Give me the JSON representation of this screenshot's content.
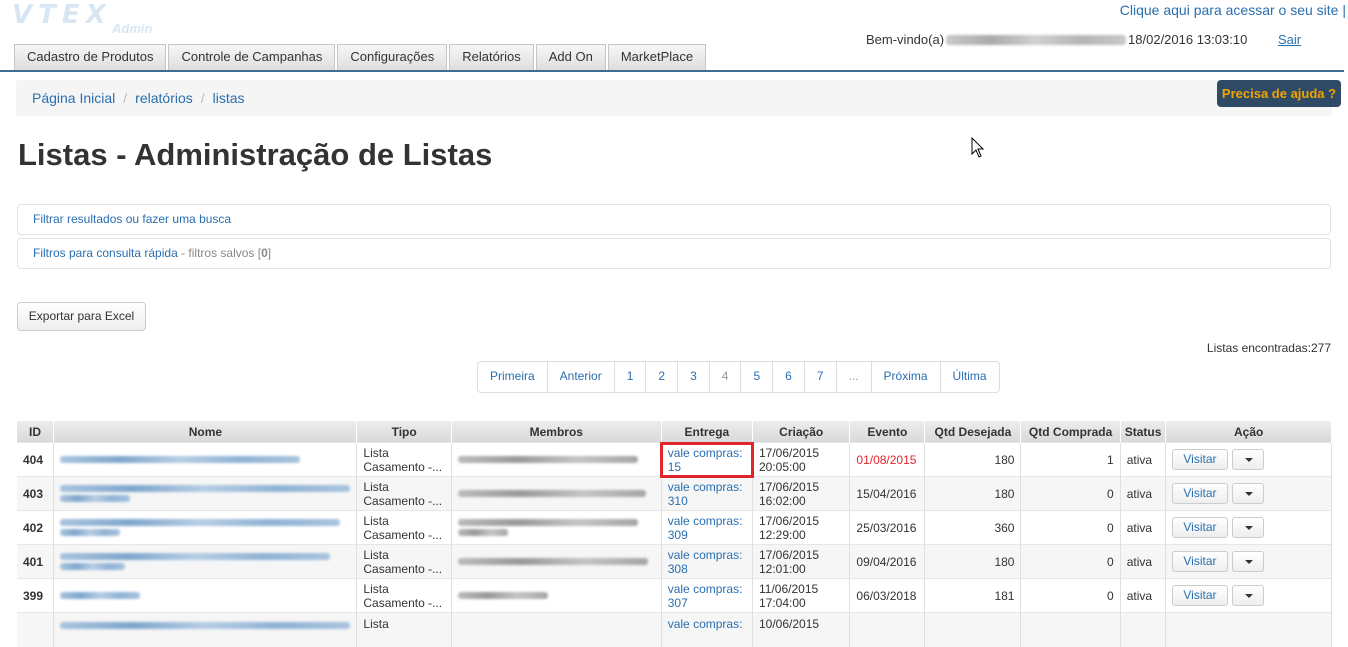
{
  "logo": {
    "main": "VTEX",
    "sub": "Admin"
  },
  "header": {
    "site_link": "Clique aqui para acessar o seu site |",
    "welcome_prefix": "Bem-vindo(a)",
    "datetime": "18/02/2016 13:03:10",
    "logout": "Sair"
  },
  "tabs": [
    "Cadastro de Produtos",
    "Controle de Campanhas",
    "Configurações",
    "Relatórios",
    "Add On",
    "MarketPlace"
  ],
  "breadcrumb": [
    "Página Inicial",
    "relatórios",
    "listas"
  ],
  "help_button": "Precisa de ajuda ?",
  "page_title": "Listas - Administração de Listas",
  "filter_panel": "Filtrar resultados ou fazer uma busca",
  "quick_filter": {
    "label": "Filtros para consulta rápida",
    "saved_prefix": " - filtros salvos [",
    "saved_count": "0",
    "saved_suffix": "]"
  },
  "export_button": "Exportar para Excel",
  "found_text": "Listas encontradas:277",
  "pagination": [
    "Primeira",
    "Anterior",
    "1",
    "2",
    "3",
    "4",
    "5",
    "6",
    "7",
    "...",
    "Próxima",
    "Última"
  ],
  "table": {
    "headers": [
      "ID",
      "Nome",
      "Tipo",
      "Membros",
      "Entrega",
      "Criação",
      "Evento",
      "Qtd Desejada",
      "Qtd Comprada",
      "Status",
      "Ação"
    ],
    "visit_label": "Visitar",
    "rows": [
      {
        "id": "404",
        "tipo1": "Lista",
        "tipo2": "Casamento -...",
        "entrega1": "vale compras:",
        "entrega2": "15",
        "criacao1": "17/06/2015",
        "criacao2": "20:05:00",
        "evento": "01/08/2015",
        "desejada": "180",
        "comprada": "1",
        "status": "ativa"
      },
      {
        "id": "403",
        "tipo1": "Lista",
        "tipo2": "Casamento -...",
        "entrega1": "vale compras:",
        "entrega2": "310",
        "criacao1": "17/06/2015",
        "criacao2": "16:02:00",
        "evento": "15/04/2016",
        "desejada": "180",
        "comprada": "0",
        "status": "ativa"
      },
      {
        "id": "402",
        "tipo1": "Lista",
        "tipo2": "Casamento -...",
        "entrega1": "vale compras:",
        "entrega2": "309",
        "criacao1": "17/06/2015",
        "criacao2": "12:29:00",
        "evento": "25/03/2016",
        "desejada": "360",
        "comprada": "0",
        "status": "ativa"
      },
      {
        "id": "401",
        "tipo1": "Lista",
        "tipo2": "Casamento -...",
        "entrega1": "vale compras:",
        "entrega2": "308",
        "criacao1": "17/06/2015",
        "criacao2": "12:01:00",
        "evento": "09/04/2016",
        "desejada": "180",
        "comprada": "0",
        "status": "ativa"
      },
      {
        "id": "399",
        "tipo1": "Lista",
        "tipo2": "Casamento -...",
        "entrega1": "vale compras:",
        "entrega2": "307",
        "criacao1": "11/06/2015",
        "criacao2": "17:04:00",
        "evento": "06/03/2018",
        "desejada": "181",
        "comprada": "0",
        "status": "ativa"
      },
      {
        "id": "",
        "tipo1": "Lista",
        "tipo2": "",
        "entrega1": "vale compras:",
        "entrega2": "",
        "criacao1": "10/06/2015",
        "criacao2": "",
        "evento": "",
        "desejada": "",
        "comprada": "",
        "status": ""
      }
    ]
  },
  "colors": {
    "accent": "#2a6fb0",
    "nav_line": "#3f6d8f",
    "help_bg": "#2e4a65",
    "help_text": "#f0a400",
    "overdue": "#e0262b"
  }
}
